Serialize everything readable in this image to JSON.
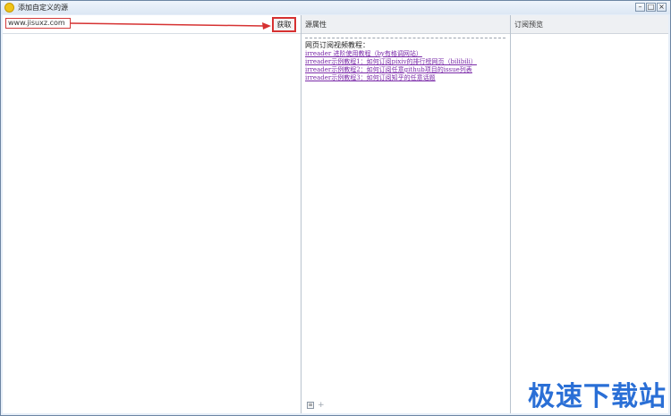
{
  "window": {
    "title": "添加自定义的源",
    "minimize_icon": "minimize-icon",
    "maximize_icon": "maximize-icon",
    "close_icon": "close-icon"
  },
  "left_panel": {
    "url_value": "www.jisuxz.com",
    "fetch_label": "获取"
  },
  "mid_panel": {
    "title": "源属性",
    "tutorial_heading": "网页订阅视频教程：",
    "tutorial_links": [
      "irreader 进阶使用教程（by有格调网站）",
      "irreader示例教程1：如何订阅pixiv的排行榜网页（bilibili）",
      "irreader示例教程2：如何订阅任意github项目的issue列表",
      "irreader示例教程3：如何订阅知乎的任意话题"
    ],
    "footer_icons": [
      "list-icon",
      "add-icon"
    ]
  },
  "right_panel": {
    "title": "订阅预览"
  },
  "watermark": {
    "text": "极速下载站"
  },
  "colors": {
    "highlight_red": "#d63232",
    "link_purple": "#7a2aa8",
    "watermark_blue": "#2a6fd6"
  }
}
